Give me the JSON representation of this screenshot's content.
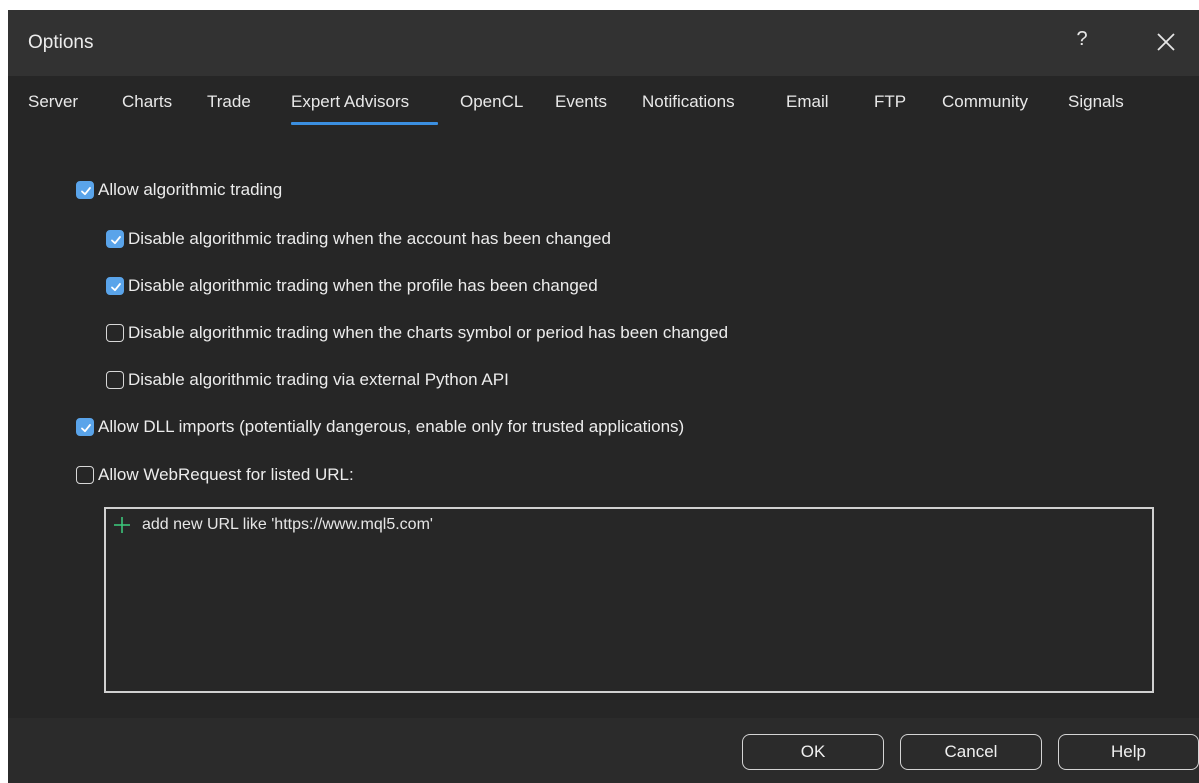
{
  "window": {
    "title": "Options",
    "help_label": "?"
  },
  "tabs": [
    {
      "label": "Server"
    },
    {
      "label": "Charts"
    },
    {
      "label": "Trade"
    },
    {
      "label": "Expert Advisors",
      "active": true
    },
    {
      "label": "OpenCL"
    },
    {
      "label": "Events"
    },
    {
      "label": "Notifications"
    },
    {
      "label": "Email"
    },
    {
      "label": "FTP"
    },
    {
      "label": "Community"
    },
    {
      "label": "Signals"
    }
  ],
  "options": {
    "allow_algo_trading": {
      "label": "Allow algorithmic trading",
      "checked": true
    },
    "disable_account_changed": {
      "label": "Disable algorithmic trading when the account has been changed",
      "checked": true
    },
    "disable_profile_changed": {
      "label": "Disable algorithmic trading when the profile has been changed",
      "checked": true
    },
    "disable_symbol_changed": {
      "label": "Disable algorithmic trading when the charts symbol or period has been changed",
      "checked": false
    },
    "disable_python_api": {
      "label": "Disable algorithmic trading via external Python API",
      "checked": false
    },
    "allow_dll": {
      "label": "Allow DLL imports (potentially dangerous, enable only for trusted applications)",
      "checked": true
    },
    "allow_webrequest": {
      "label": "Allow WebRequest for listed URL:",
      "checked": false
    }
  },
  "url_list": {
    "add_hint": "add new URL like 'https://www.mql5.com'"
  },
  "buttons": {
    "ok": "OK",
    "cancel": "Cancel",
    "help": "Help"
  },
  "colors": {
    "accent": "#3b8fe0",
    "checkbox_checked": "#5aa4ea",
    "plus_icon": "#3cc47a"
  }
}
